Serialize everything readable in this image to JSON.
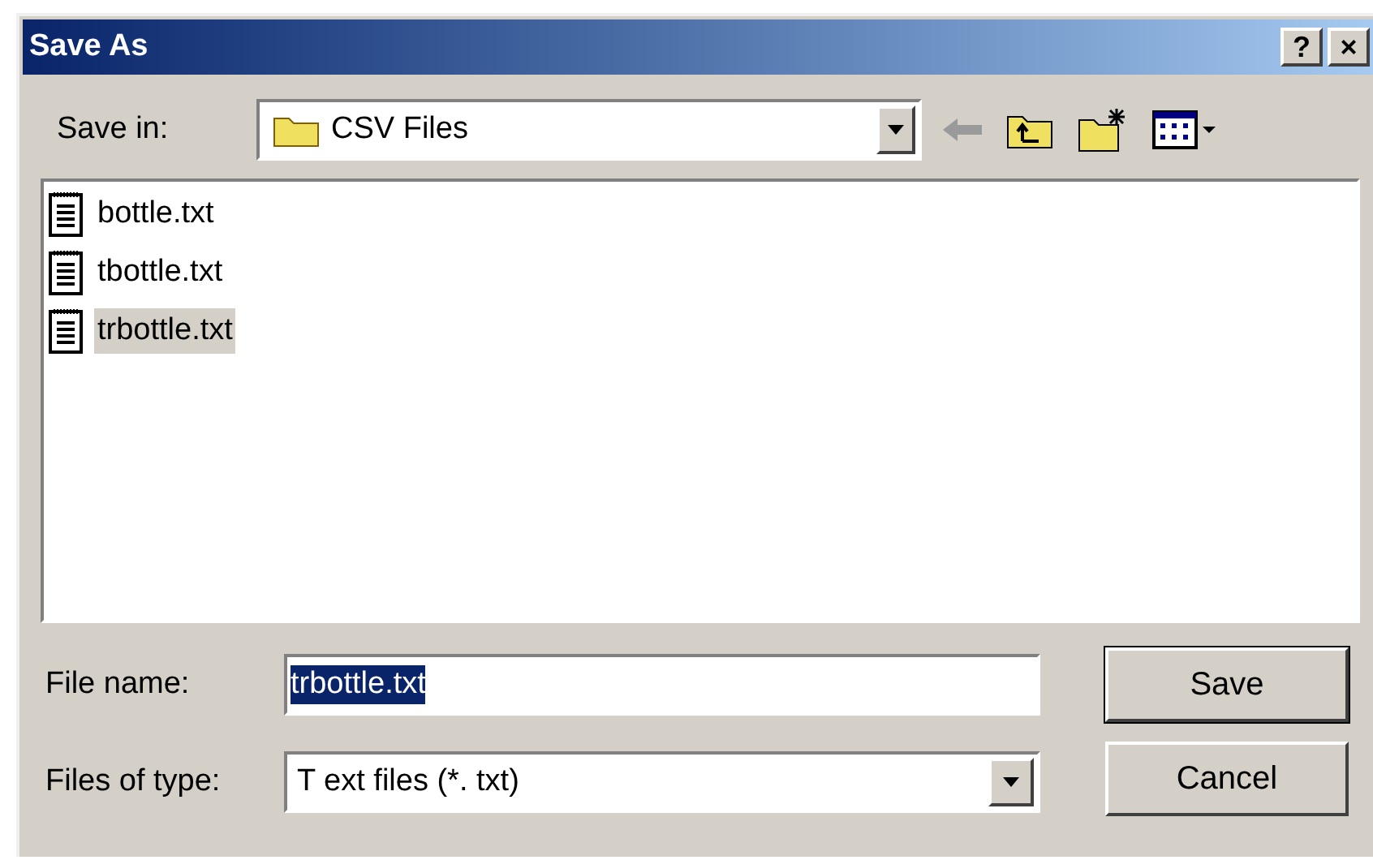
{
  "window": {
    "title": "Save As",
    "title_buttons": [
      "?",
      "×"
    ]
  },
  "save_in": {
    "label": "Save in:",
    "value": "CSV Files"
  },
  "files": [
    {
      "name": "bottle.txt",
      "selected": false
    },
    {
      "name": "tbottle.txt",
      "selected": false
    },
    {
      "name": "trbottle.txt",
      "selected": true
    }
  ],
  "file_name": {
    "label": "File name:",
    "value": "trbottle.txt"
  },
  "file_type": {
    "label": "Files of type:",
    "value": "T ext files (*. txt)"
  },
  "buttons": [
    {
      "label": "Save",
      "default": true
    },
    {
      "label": "Cancel",
      "default": false
    }
  ]
}
